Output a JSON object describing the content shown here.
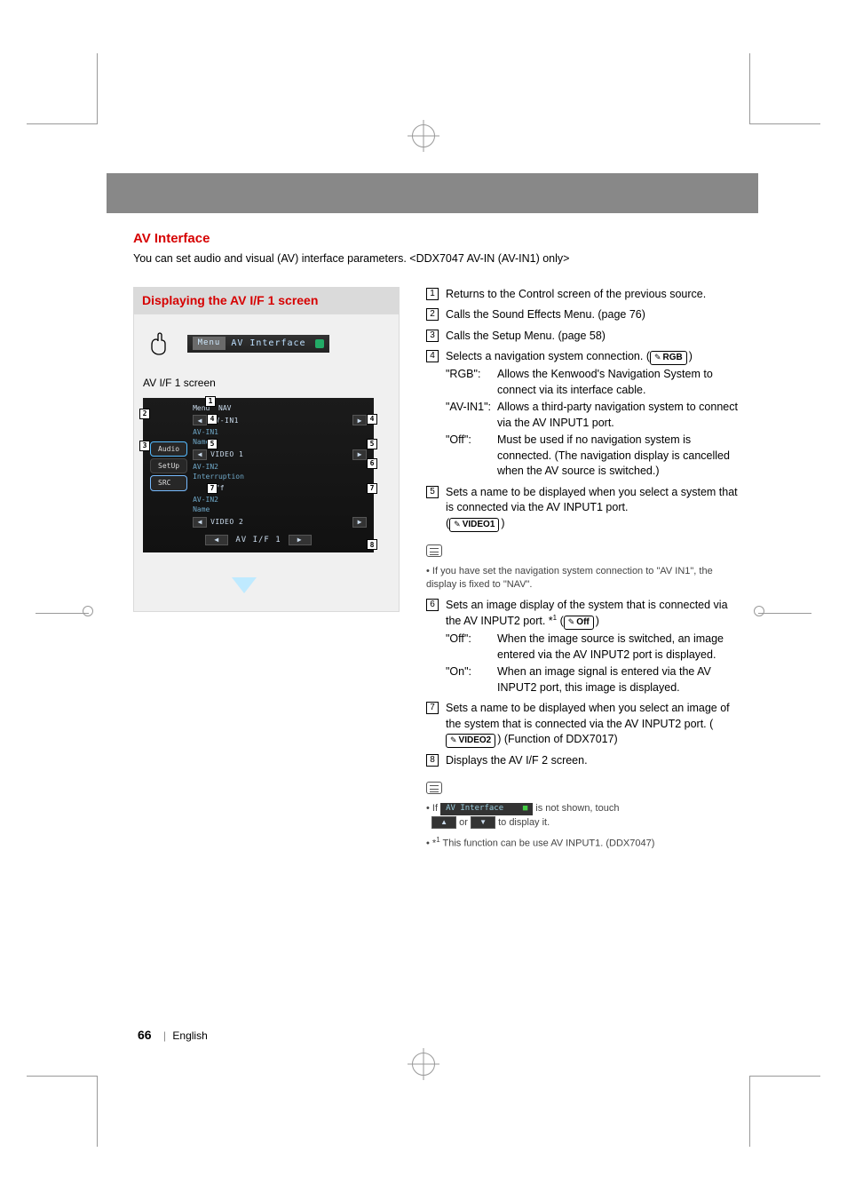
{
  "header": {
    "title": "AV Interface",
    "subtitle": "You can set audio and visual (AV) interface parameters. <DDX7047 AV-IN (AV-IN1) only>"
  },
  "panel": {
    "heading": "Displaying the AV I/F 1 screen",
    "strip_button": "Menu",
    "strip_label": "AV Interface",
    "caption": "AV I/F 1 screen"
  },
  "screenshot": {
    "tabs": {
      "audio": "Audio",
      "setup": "SetUp",
      "src": "SRC"
    },
    "top_label": "Menu",
    "nav": "NAV",
    "rows": {
      "r1_label": "",
      "r1_val": "AV-IN1",
      "r2_label": "AV-IN1",
      "r2_sub": "Name",
      "r2_val": "VIDEO 1",
      "r3_label": "AV-IN2",
      "r3_sub": "Interruption",
      "r3_val": "Off",
      "r4_label": "AV-IN2",
      "r4_sub": "Name",
      "r4_val": "VIDEO 2"
    },
    "bottom": "AV I/F 1"
  },
  "items": {
    "i1": "Returns to the Control screen of the previous source.",
    "i2": "Calls the Sound Effects Menu. (page 76)",
    "i3": "Calls the Setup Menu. (page 58)",
    "i4": {
      "lead": "Selects a navigation system connection. (",
      "def": "RGB",
      "tail": ")",
      "opts": [
        {
          "k": "\"RGB\":",
          "v": "Allows the Kenwood's Navigation System to connect via its interface cable."
        },
        {
          "k": "\"AV-IN1\":",
          "v": "Allows a third-party navigation system to connect via the AV INPUT1 port."
        },
        {
          "k": "\"Off\":",
          "v": "Must be used if no navigation system is connected. (The navigation display is cancelled when the AV source is switched.)"
        }
      ]
    },
    "i5": {
      "text": "Sets a name to be displayed when you select a system that is connected via the AV INPUT1 port.",
      "def": "VIDEO1"
    },
    "note5": "If you have set the navigation system connection to \"AV IN1\", the display is fixed to \"NAV\".",
    "i6": {
      "lead": "Sets an image display of the system that is connected via the AV INPUT2 port. *",
      "sup": "1",
      "open": " (",
      "def": "Off",
      "tail": ")",
      "opts": [
        {
          "k": "\"Off\":",
          "v": "When the image source is switched, an image entered via the AV INPUT2 port is displayed."
        },
        {
          "k": "\"On\":",
          "v": "When an image signal is entered via the AV INPUT2 port, this image is displayed."
        }
      ]
    },
    "i7": {
      "text": "Sets a name to be displayed when you select an image of the system that is connected via the AV INPUT2 port. (",
      "def": "VIDEO2",
      "tail": ") (Function of DDX7017)"
    },
    "i8": "Displays the AV I/F 2 screen.",
    "note8a_pre": "If ",
    "note8a_bar": "AV Interface",
    "note8a_mid": " is not shown, touch ",
    "note8a_or": " or ",
    "note8a_post": " to display it.",
    "note8b_pre": "*",
    "note8b_sup": "1",
    "note8b_txt": " This function can be use AV INPUT1. (DDX7047)"
  },
  "footer": {
    "page": "66",
    "lang": "English"
  }
}
